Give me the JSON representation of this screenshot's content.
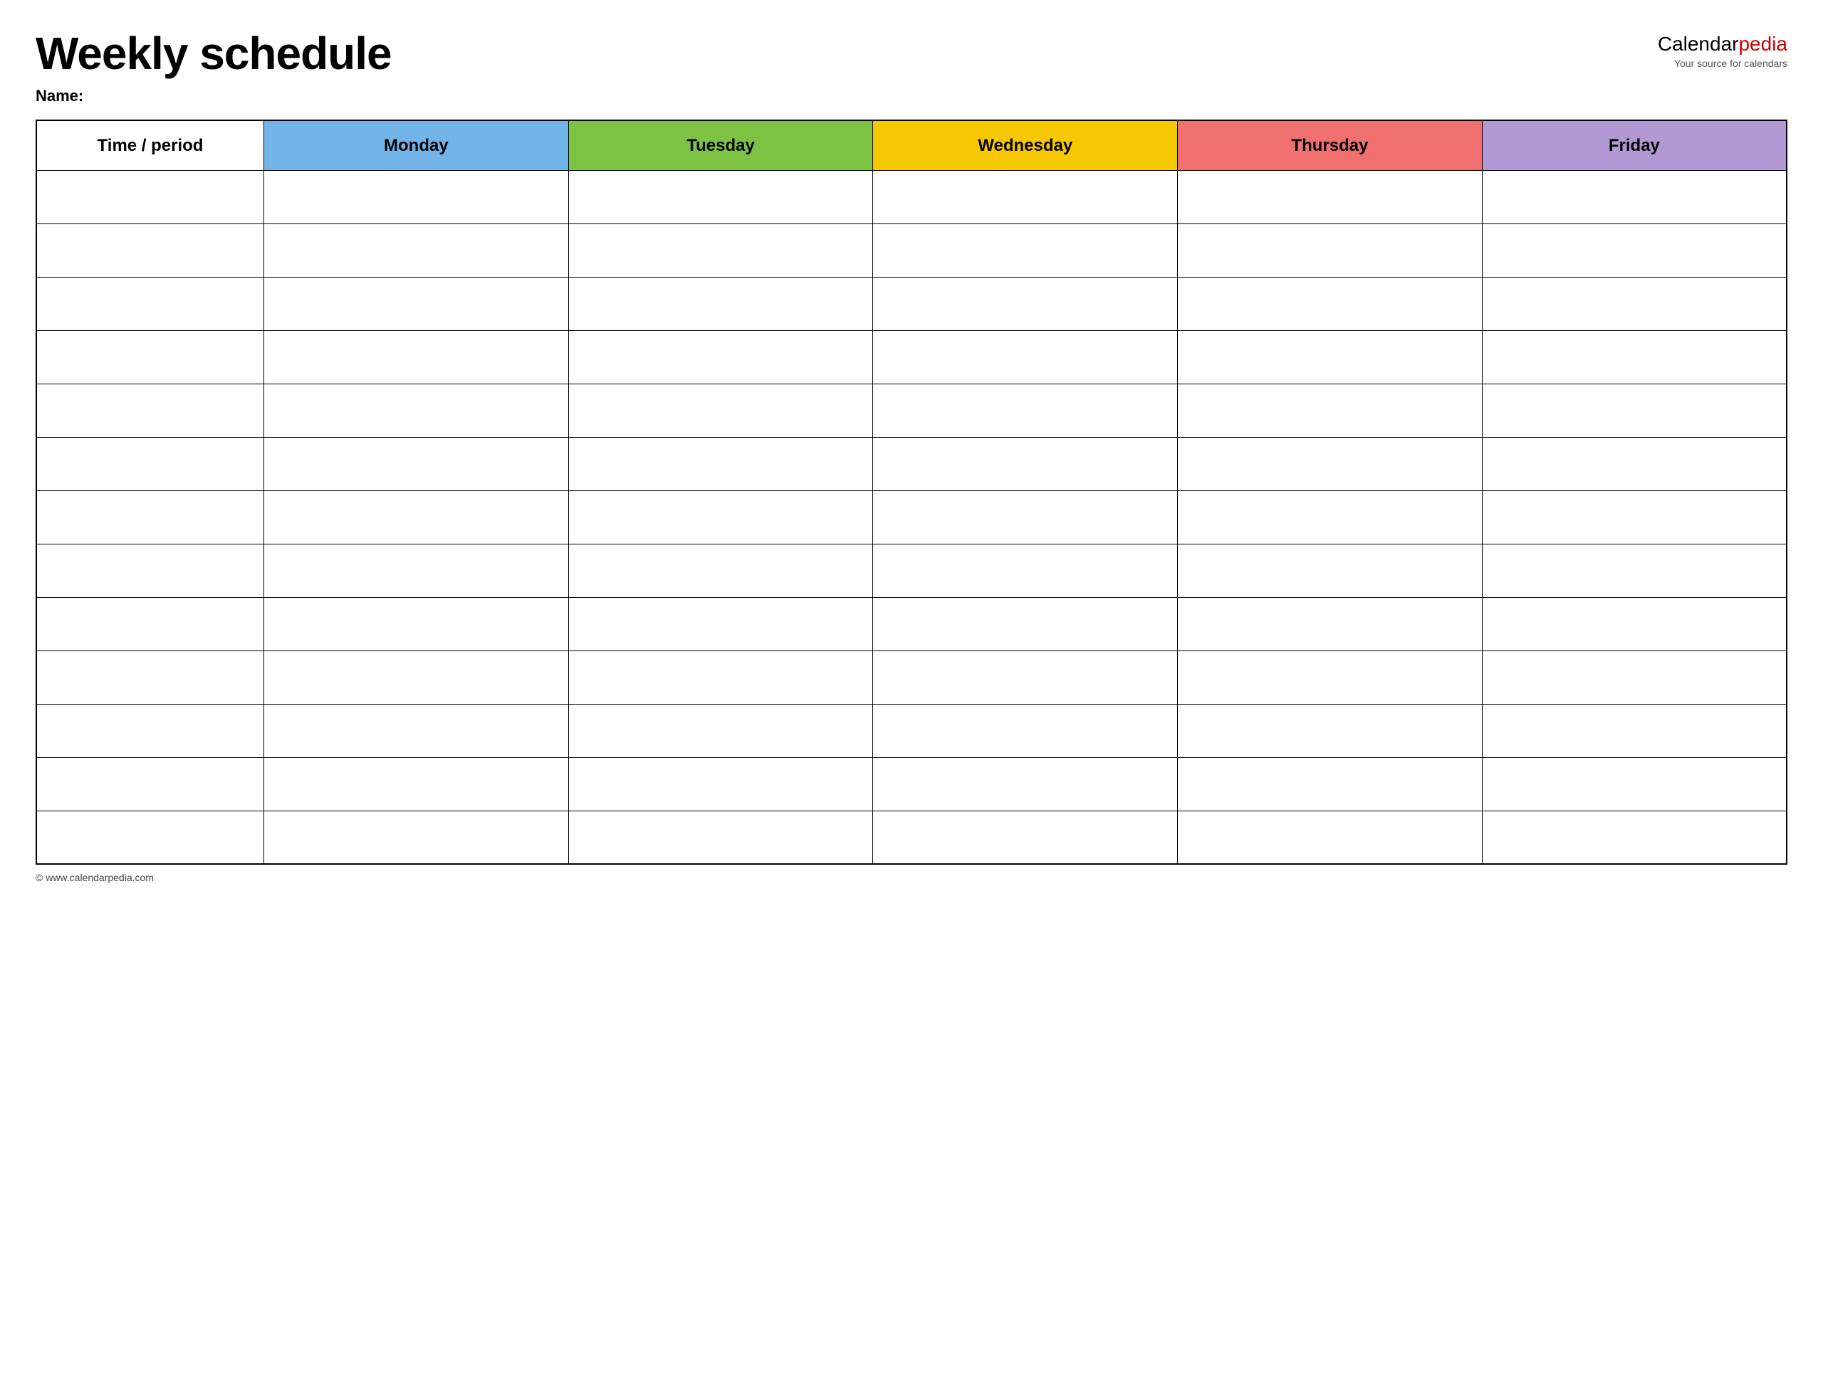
{
  "header": {
    "main_title": "Weekly schedule",
    "name_label": "Name:",
    "logo": {
      "calendar_part": "Calendar",
      "pedia_part": "pedia",
      "tagline": "Your source for calendars"
    }
  },
  "table": {
    "columns": [
      {
        "key": "time",
        "label": "Time / period",
        "color_class": "col-time"
      },
      {
        "key": "monday",
        "label": "Monday",
        "color_class": "col-monday"
      },
      {
        "key": "tuesday",
        "label": "Tuesday",
        "color_class": "col-tuesday"
      },
      {
        "key": "wednesday",
        "label": "Wednesday",
        "color_class": "col-wednesday"
      },
      {
        "key": "thursday",
        "label": "Thursday",
        "color_class": "col-thursday"
      },
      {
        "key": "friday",
        "label": "Friday",
        "color_class": "col-friday"
      }
    ],
    "row_count": 13
  },
  "footer": {
    "url": "© www.calendarpedia.com"
  }
}
